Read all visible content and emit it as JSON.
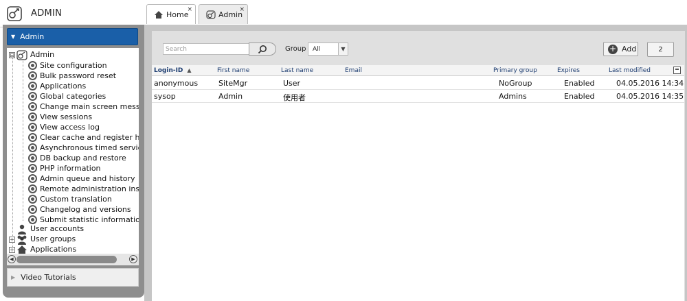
{
  "app": {
    "title": "ADMIN"
  },
  "tabs": [
    {
      "label": "Home",
      "close": "×"
    },
    {
      "label": "Admin",
      "close": "×"
    }
  ],
  "sidebar": {
    "panel_title": "Admin",
    "panel_arrow": "▼",
    "tree": {
      "root": {
        "label": "Admin",
        "expander": "⊟"
      },
      "children": [
        "Site configuration",
        "Bulk password reset",
        "Applications",
        "Global categories",
        "Change main screen messa",
        "View sessions",
        "View access log",
        "Clear cache and register ho",
        "Asynchronous timed service",
        "DB backup and restore",
        "PHP information",
        "Admin queue and history",
        "Remote administration insta",
        "Custom translation",
        "Changelog and versions",
        "Submit statistic information"
      ],
      "siblings": [
        {
          "label": "User accounts",
          "expander": "",
          "icon": "user-icon"
        },
        {
          "label": "User groups",
          "expander": "+",
          "icon": "user-group-icon"
        },
        {
          "label": "Applications",
          "expander": "+",
          "icon": "home-icon"
        }
      ]
    },
    "scroll_left": "◀",
    "scroll_right": "▶",
    "video_tutorials": "Video Tutorials",
    "video_arrow": "▶"
  },
  "toolbar": {
    "search_placeholder": "Search",
    "group_label": "Group",
    "group_value": "All",
    "group_caret": "▼",
    "add_label": "Add",
    "add_plus": "+",
    "count": "2"
  },
  "table": {
    "sort_arrow": "▲",
    "columns": [
      "Login-ID",
      "First name",
      "Last name",
      "Email",
      "Primary group",
      "Expires",
      "Last modified"
    ],
    "rows": [
      [
        "anonymous",
        "SiteMgr",
        "User",
        "",
        "NoGroup",
        "Enabled",
        "04.05.2016 14:34"
      ],
      [
        "sysop",
        "Admin",
        "使用者",
        "",
        "Admins",
        "Enabled",
        "04.05.2016 14:35"
      ]
    ]
  },
  "colors": {
    "panel_header": "#1a5fa8",
    "frame_gray": "#8e8e8e",
    "main_gray": "#c6c6c6",
    "header_text": "#1b3b6f"
  }
}
